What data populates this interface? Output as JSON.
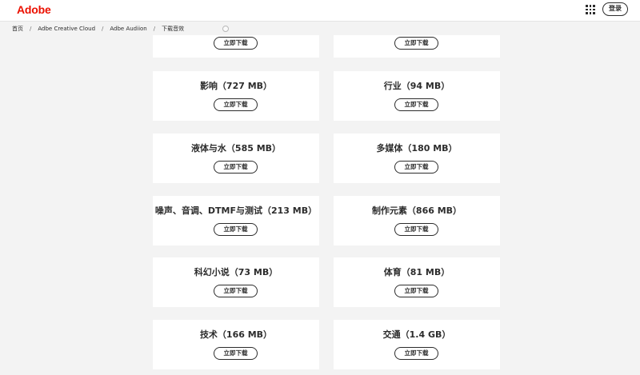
{
  "header": {
    "logo_text": "Adobe",
    "apps_icon": "app-grid-icon",
    "signin_label": "登录",
    "brand_color": "#eb1000"
  },
  "breadcrumb": {
    "items": [
      "首页",
      "Adbe Creative Cloud",
      "Adbe Audiion",
      "下载音效"
    ],
    "separator": "/"
  },
  "downloads": {
    "button_label": "立即下载",
    "rows": [
      {
        "left": "",
        "right": ""
      },
      {
        "left": "影响（727 MB）",
        "right": "行业（94 MB）"
      },
      {
        "left": "液体与水（585 MB）",
        "right": "多媒体（180 MB）"
      },
      {
        "left": "噪声、音调、DTMF与测试（213 MB）",
        "right": "制作元素（866 MB）"
      },
      {
        "left": "科幻小说（73 MB）",
        "right": "体育（81 MB）"
      },
      {
        "left": "技术（166 MB）",
        "right": "交通（1.4 GB）"
      }
    ]
  }
}
